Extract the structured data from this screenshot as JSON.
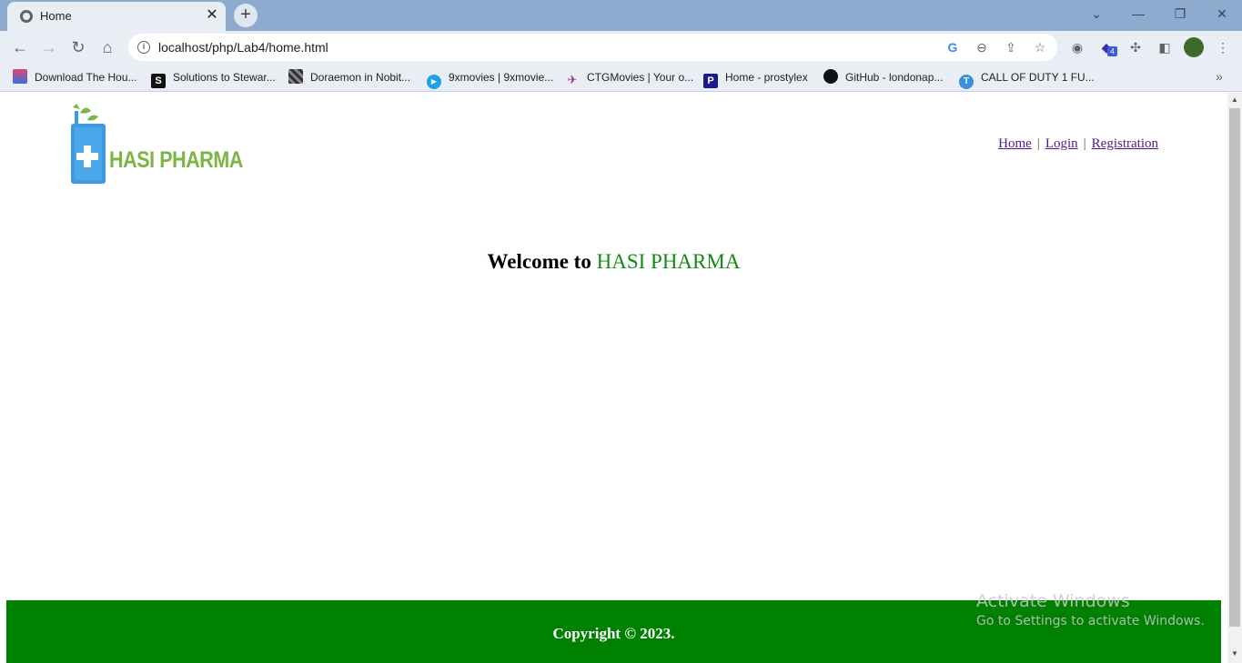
{
  "browser": {
    "tab_title": "Home",
    "url": "localhost/php/Lab4/home.html",
    "bookmarks": [
      {
        "label": "Download The Hou...",
        "icon": "rainbow-icon",
        "color": "#e0457b"
      },
      {
        "label": "Solutions to Stewar...",
        "icon": "s-icon",
        "color": "#111111"
      },
      {
        "label": "Doraemon in Nobit...",
        "icon": "mosaic-icon",
        "color": "#444444"
      },
      {
        "label": "9xmovies | 9xmovie...",
        "icon": "play-icon",
        "color": "#1aa3e8"
      },
      {
        "label": "CTGMovies | Your o...",
        "icon": "plane-icon",
        "color": "#9b2c8a"
      },
      {
        "label": "Home - prostylex",
        "icon": "p-icon",
        "color": "#1a1a8c"
      },
      {
        "label": "GitHub - londonap...",
        "icon": "github-icon",
        "color": "#111111"
      },
      {
        "label": "CALL OF DUTY 1 FU...",
        "icon": "t-icon",
        "color": "#3b8ee0"
      }
    ],
    "extension_badge": "4"
  },
  "page": {
    "logo_text": "HASI PHARMA",
    "nav": {
      "home": "Home",
      "login": "Login",
      "registration": "Registration",
      "separator": "|"
    },
    "welcome_prefix": "Welcome to",
    "welcome_brand": "HASI PHARMA",
    "footer_text": "Copyright © 2023."
  },
  "watermark": {
    "line1": "Activate Windows",
    "line2": "Go to Settings to activate Windows."
  },
  "colors": {
    "brand_green": "#138a13",
    "footer_green": "#008000",
    "logo_green": "#7bb542",
    "logo_blue": "#3b9ae0",
    "link_purple": "#551a8b"
  }
}
